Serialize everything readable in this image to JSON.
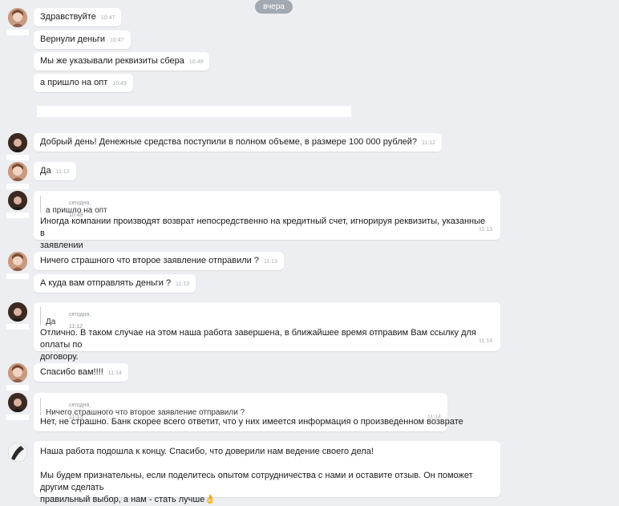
{
  "date_divider": "вчера",
  "messages": [
    {
      "text": "Здравствуйте",
      "time": "10:47"
    },
    {
      "text": "Вернули деньги",
      "time": "10:47"
    },
    {
      "text": "Мы же указывали реквизиты сбера",
      "time": "10:49"
    },
    {
      "text": "а пришло на опт",
      "time": "10:49"
    },
    {
      "text": "Добрый день! Денежные средства поступили в полном объеме, в размере 100 000 рублей?",
      "time": "11:12"
    },
    {
      "text": "Да",
      "time": "11:12"
    },
    {
      "quote_meta": "сегодня, 10:49",
      "quote_text": "а пришло на опт",
      "line1": "Иногда компании производят возврат непосредственно на кредитный счет, игнорируя реквизиты, указанные в",
      "line2": "заявлении",
      "time": "11:13"
    },
    {
      "text": "Ничего страшного что второе заявление отправили ?",
      "time": "11:13"
    },
    {
      "text": "А куда вам отправлять деньги ?",
      "time": "11:13"
    },
    {
      "quote_meta": "сегодня, 11:12",
      "quote_text": "Да",
      "line1": "Отлично. В таком случае на этом наша работа завершена, в ближайшее время отправим Вам ссылку для оплаты по",
      "line2": "договору.",
      "time": "11:14"
    },
    {
      "text": "Спасибо вам!!!!",
      "time": "11:14"
    },
    {
      "quote_meta": "сегодня, 11:13",
      "quote_text": "Ничего страшного что второе заявление отправили ?",
      "line1": "Нет, не страшно. Банк скорее всего ответит, что у них имеется информация о произведенном возврате",
      "time": "11:14"
    },
    {
      "line1": "Наша работа подошла к концу. Спасибо, что доверили нам ведение своего дела!",
      "line2": "Мы будем признательны, если поделитесь опытом сотрудничества с нами и оставите отзыв. Он поможет другим сделать",
      "line3": "правильный выбор, а нам - стать лучше",
      "emoji": "👌"
    }
  ]
}
